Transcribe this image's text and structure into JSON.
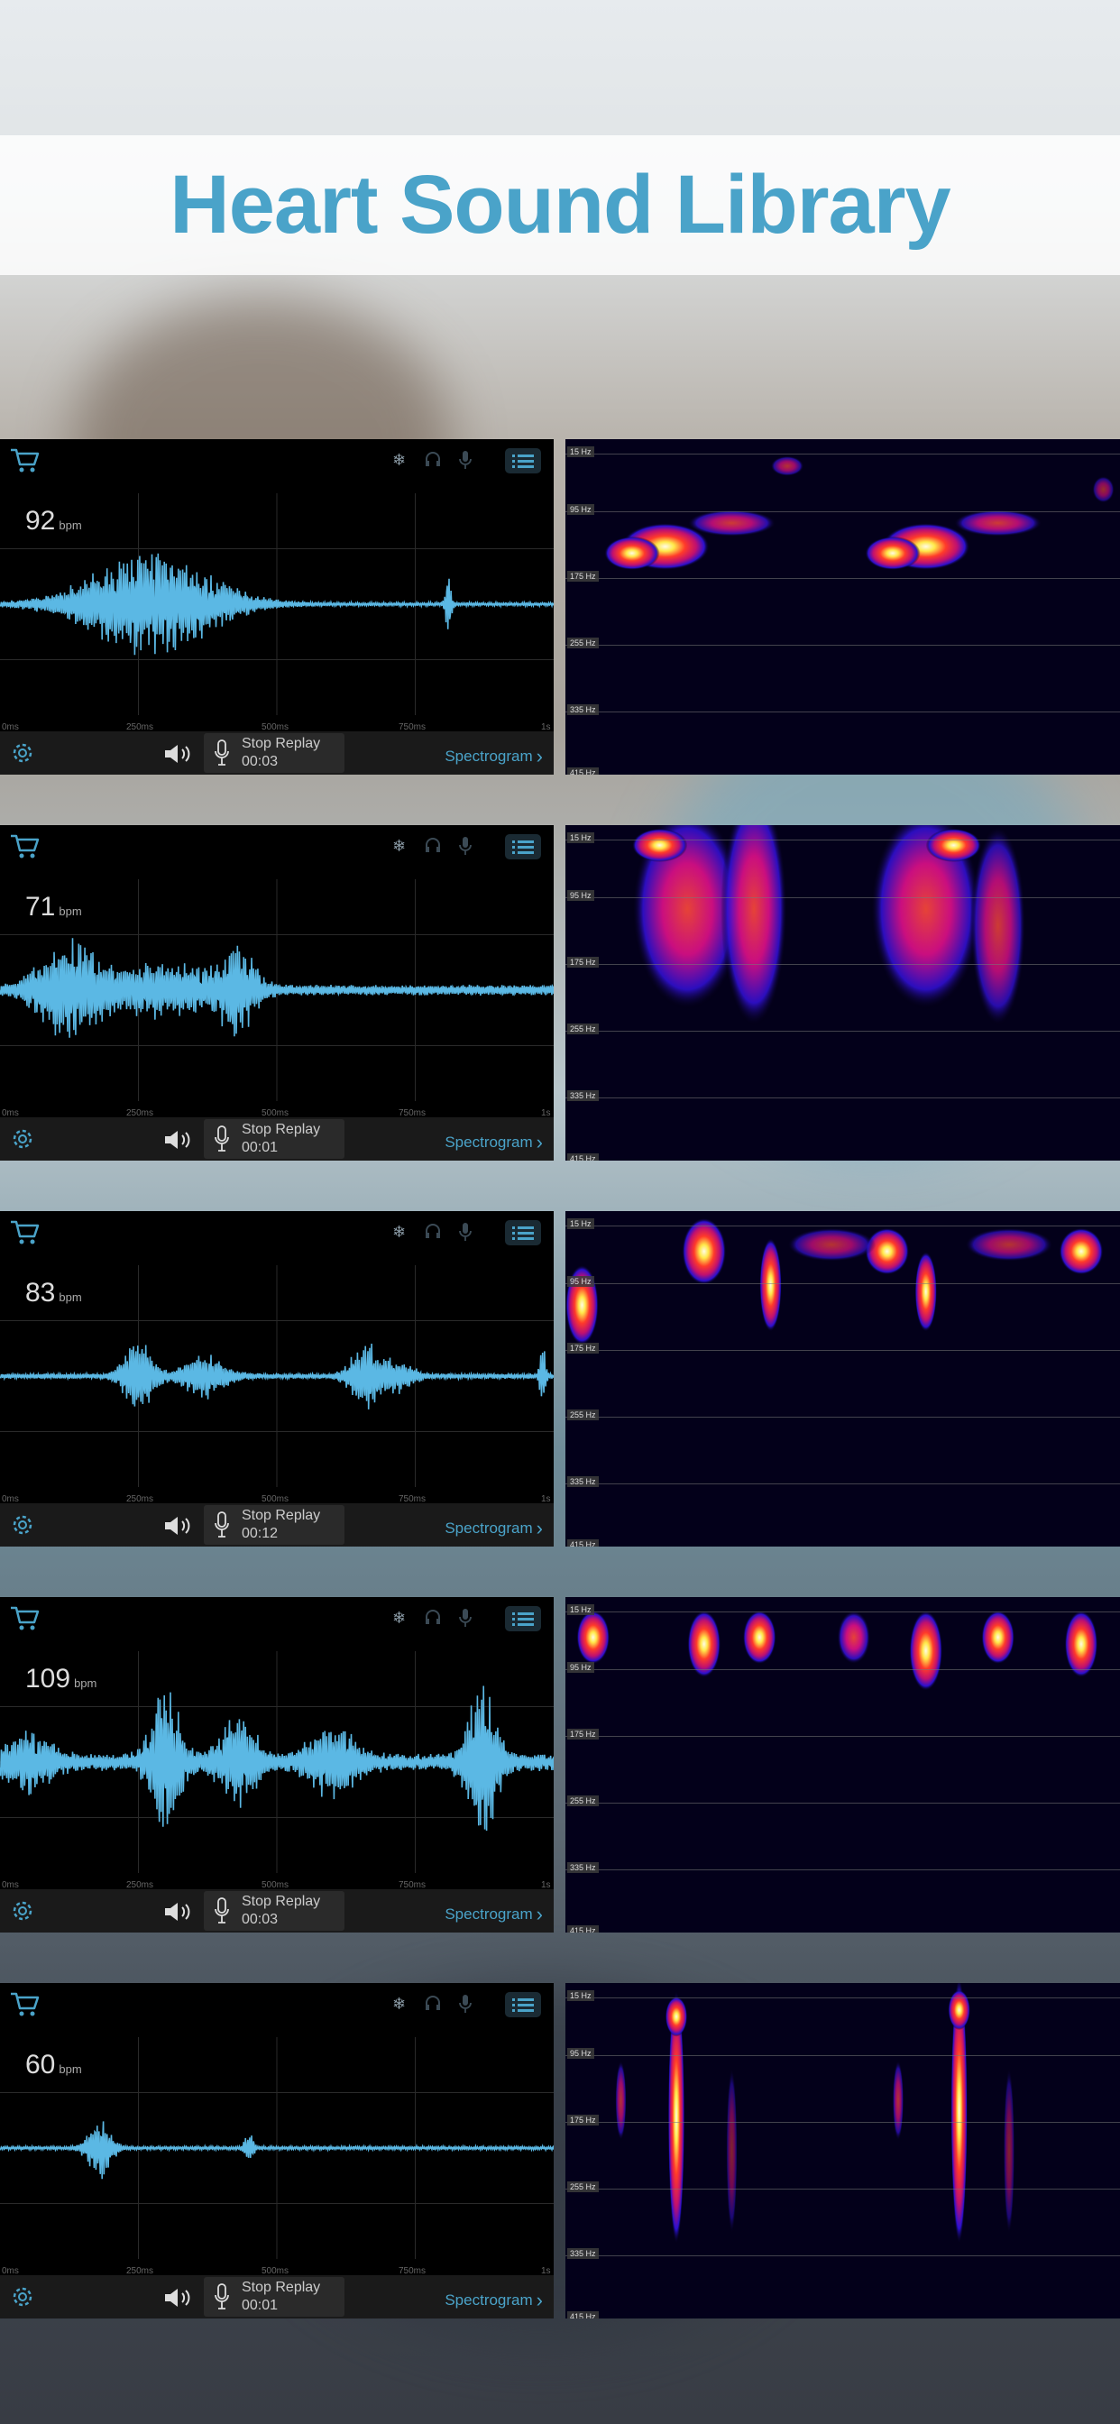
{
  "title": "Heart Sound Library",
  "colors": {
    "accent": "#4aa3c9",
    "title": "#4aa3c9"
  },
  "icons": [
    "cart-icon",
    "snowflake-icon",
    "headphones-icon",
    "microphone-icon",
    "list-icon",
    "gear-icon",
    "speaker-icon",
    "chevron-right-icon"
  ],
  "x_ticks": [
    "0ms",
    "250ms",
    "500ms",
    "750ms",
    "1s"
  ],
  "hz_ticks": [
    "15 Hz",
    "95 Hz",
    "175 Hz",
    "255 Hz",
    "335 Hz",
    "415 Hz"
  ],
  "recordings": [
    {
      "bpm": "92",
      "bpm_unit": "bpm",
      "replay_label": "Stop Replay",
      "time": "00:03",
      "spec_label": "Spectrogram"
    },
    {
      "bpm": "71",
      "bpm_unit": "bpm",
      "replay_label": "Stop Replay",
      "time": "00:01",
      "spec_label": "Spectrogram"
    },
    {
      "bpm": "83",
      "bpm_unit": "bpm",
      "replay_label": "Stop Replay",
      "time": "00:12",
      "spec_label": "Spectrogram"
    },
    {
      "bpm": "109",
      "bpm_unit": "bpm",
      "replay_label": "Stop Replay",
      "time": "00:03",
      "spec_label": "Spectrogram"
    },
    {
      "bpm": "60",
      "bpm_unit": "bpm",
      "replay_label": "Stop Replay",
      "time": "00:01",
      "spec_label": "Spectrogram"
    }
  ]
}
